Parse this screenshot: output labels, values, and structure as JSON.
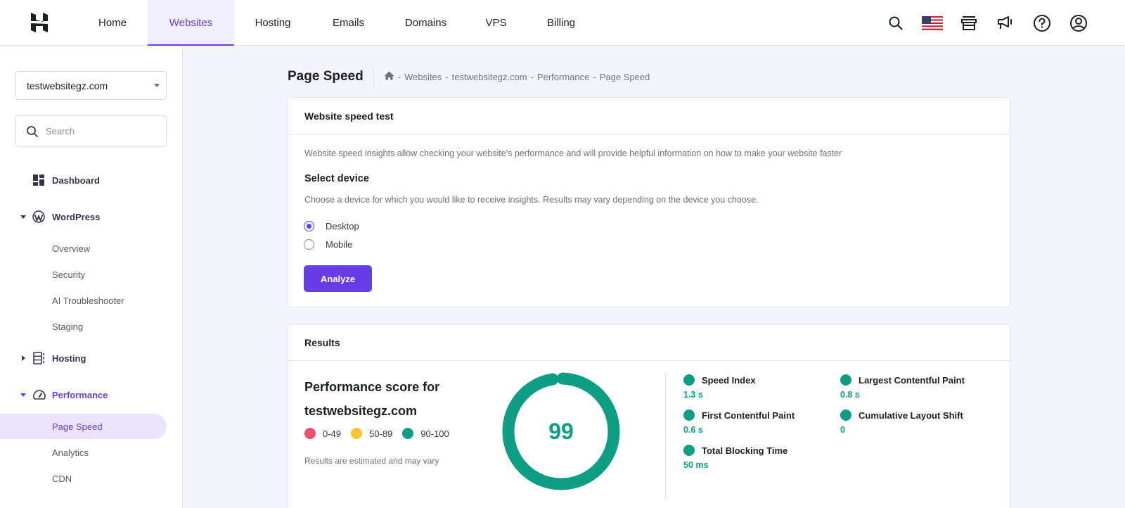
{
  "topnav": {
    "items": [
      {
        "label": "Home",
        "active": false
      },
      {
        "label": "Websites",
        "active": true
      },
      {
        "label": "Hosting",
        "active": false
      },
      {
        "label": "Emails",
        "active": false
      },
      {
        "label": "Domains",
        "active": false
      },
      {
        "label": "VPS",
        "active": false
      },
      {
        "label": "Billing",
        "active": false
      }
    ],
    "icons": [
      "search-icon",
      "us-flag-icon",
      "store-icon",
      "megaphone-icon",
      "help-icon",
      "account-icon"
    ]
  },
  "sidebar": {
    "site_selected": "testwebsitegz.com",
    "search_placeholder": "Search",
    "dashboard": "Dashboard",
    "wordpress": "WordPress",
    "wordpress_items": [
      "Overview",
      "Security",
      "AI Troubleshooter",
      "Staging"
    ],
    "hosting": "Hosting",
    "performance": "Performance",
    "performance_items": [
      "Page Speed",
      "Analytics",
      "CDN"
    ],
    "active_item": "Page Speed"
  },
  "page": {
    "title": "Page Speed",
    "breadcrumb": [
      "Websites",
      "testwebsitegz.com",
      "Performance",
      "Page Speed"
    ]
  },
  "speed_test": {
    "title": "Website speed test",
    "intro": "Website speed insights allow checking your website's performance and will provide helpful information on how to make your website faster",
    "select_title": "Select device",
    "select_desc": "Choose a device for which you would like to receive insights. Results may vary depending on the device you choose.",
    "devices": [
      {
        "label": "Desktop",
        "checked": true
      },
      {
        "label": "Mobile",
        "checked": false
      }
    ],
    "analyze_label": "Analyze"
  },
  "results": {
    "title": "Results",
    "score_title": "Performance score for testwebsitegz.com",
    "legend": [
      {
        "label": "0-49",
        "color": "#f0506e"
      },
      {
        "label": "50-89",
        "color": "#fcc52f"
      },
      {
        "label": "90-100",
        "color": "#0d9e83"
      }
    ],
    "note": "Results are estimated and may vary",
    "score": 99,
    "score_color": "#0d9e83",
    "metrics": [
      {
        "name": "Speed Index",
        "value": "1.3 s"
      },
      {
        "name": "Largest Contentful Paint",
        "value": "0.8 s"
      },
      {
        "name": "First Contentful Paint",
        "value": "0.6 s"
      },
      {
        "name": "Cumulative Layout Shift",
        "value": "0"
      },
      {
        "name": "Total Blocking Time",
        "value": "50 ms"
      }
    ]
  },
  "colors": {
    "accent": "#673de6",
    "good": "#0d9e83"
  }
}
